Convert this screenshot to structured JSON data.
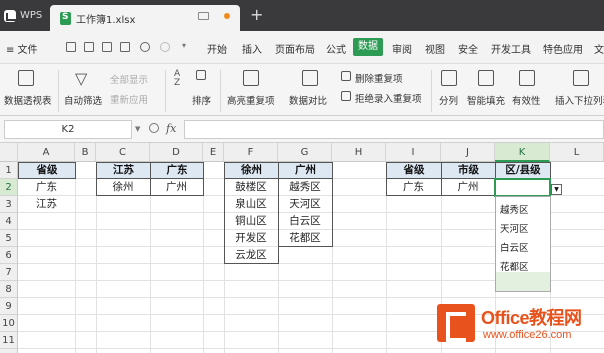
{
  "titlebar": {
    "app_name": "WPS",
    "file_tab": "工作簿1.xlsx",
    "new_tab": "+"
  },
  "menubar": {
    "file_menu": "≡ 文件",
    "items": [
      "开始",
      "插入",
      "页面布局",
      "公式",
      "数据",
      "审阅",
      "视图",
      "安全",
      "开发工具",
      "特色应用",
      "文"
    ],
    "active_index": 4
  },
  "ribbon": {
    "pivot_table": "数据透视表",
    "auto_filter": "自动筛选",
    "show_all": "全部显示",
    "reapply": "重新应用",
    "sort": "排序",
    "highlight_dupes": "高亮重复项",
    "data_compare": "数据对比",
    "remove_dupes": "删除重复项",
    "reject_dupes": "拒绝录入重复项",
    "split": "分列",
    "smart_fill": "智能填充",
    "validity": "有效性",
    "insert_dropdown": "插入下拉列表"
  },
  "formulabar": {
    "cell_ref": "K2",
    "fx": "fx",
    "value": ""
  },
  "grid": {
    "columns": [
      "A",
      "B",
      "C",
      "D",
      "E",
      "F",
      "G",
      "H",
      "I",
      "J",
      "K",
      "L"
    ],
    "rows": [
      "1",
      "2",
      "3",
      "4",
      "5",
      "6",
      "7",
      "8",
      "9",
      "10",
      "11",
      "12"
    ],
    "selected_column": "K",
    "selected_row": "2",
    "cells": {
      "A1": "省级",
      "A2": "广东",
      "A3": "江苏",
      "C1": "江苏",
      "D1": "广东",
      "C2": "徐州",
      "D2": "广州",
      "F1": "徐州",
      "G1": "广州",
      "F2": "鼓楼区",
      "F3": "泉山区",
      "F4": "铜山区",
      "F5": "开发区",
      "F6": "云龙区",
      "G2": "越秀区",
      "G3": "天河区",
      "G4": "白云区",
      "G5": "花都区",
      "I1": "省级",
      "J1": "市级",
      "K1": "区/县级",
      "I2": "广东",
      "J2": "广州"
    }
  },
  "dropdown": {
    "options": [
      "越秀区",
      "天河区",
      "白云区",
      "花都区"
    ]
  },
  "watermark": {
    "title": "Office教程网",
    "url": "www.office26.com"
  },
  "colors": {
    "accent": "#2e9b54",
    "titlebar": "#3a3a3d",
    "header_fill": "#dde8f3",
    "watermark": "#e8521c"
  }
}
